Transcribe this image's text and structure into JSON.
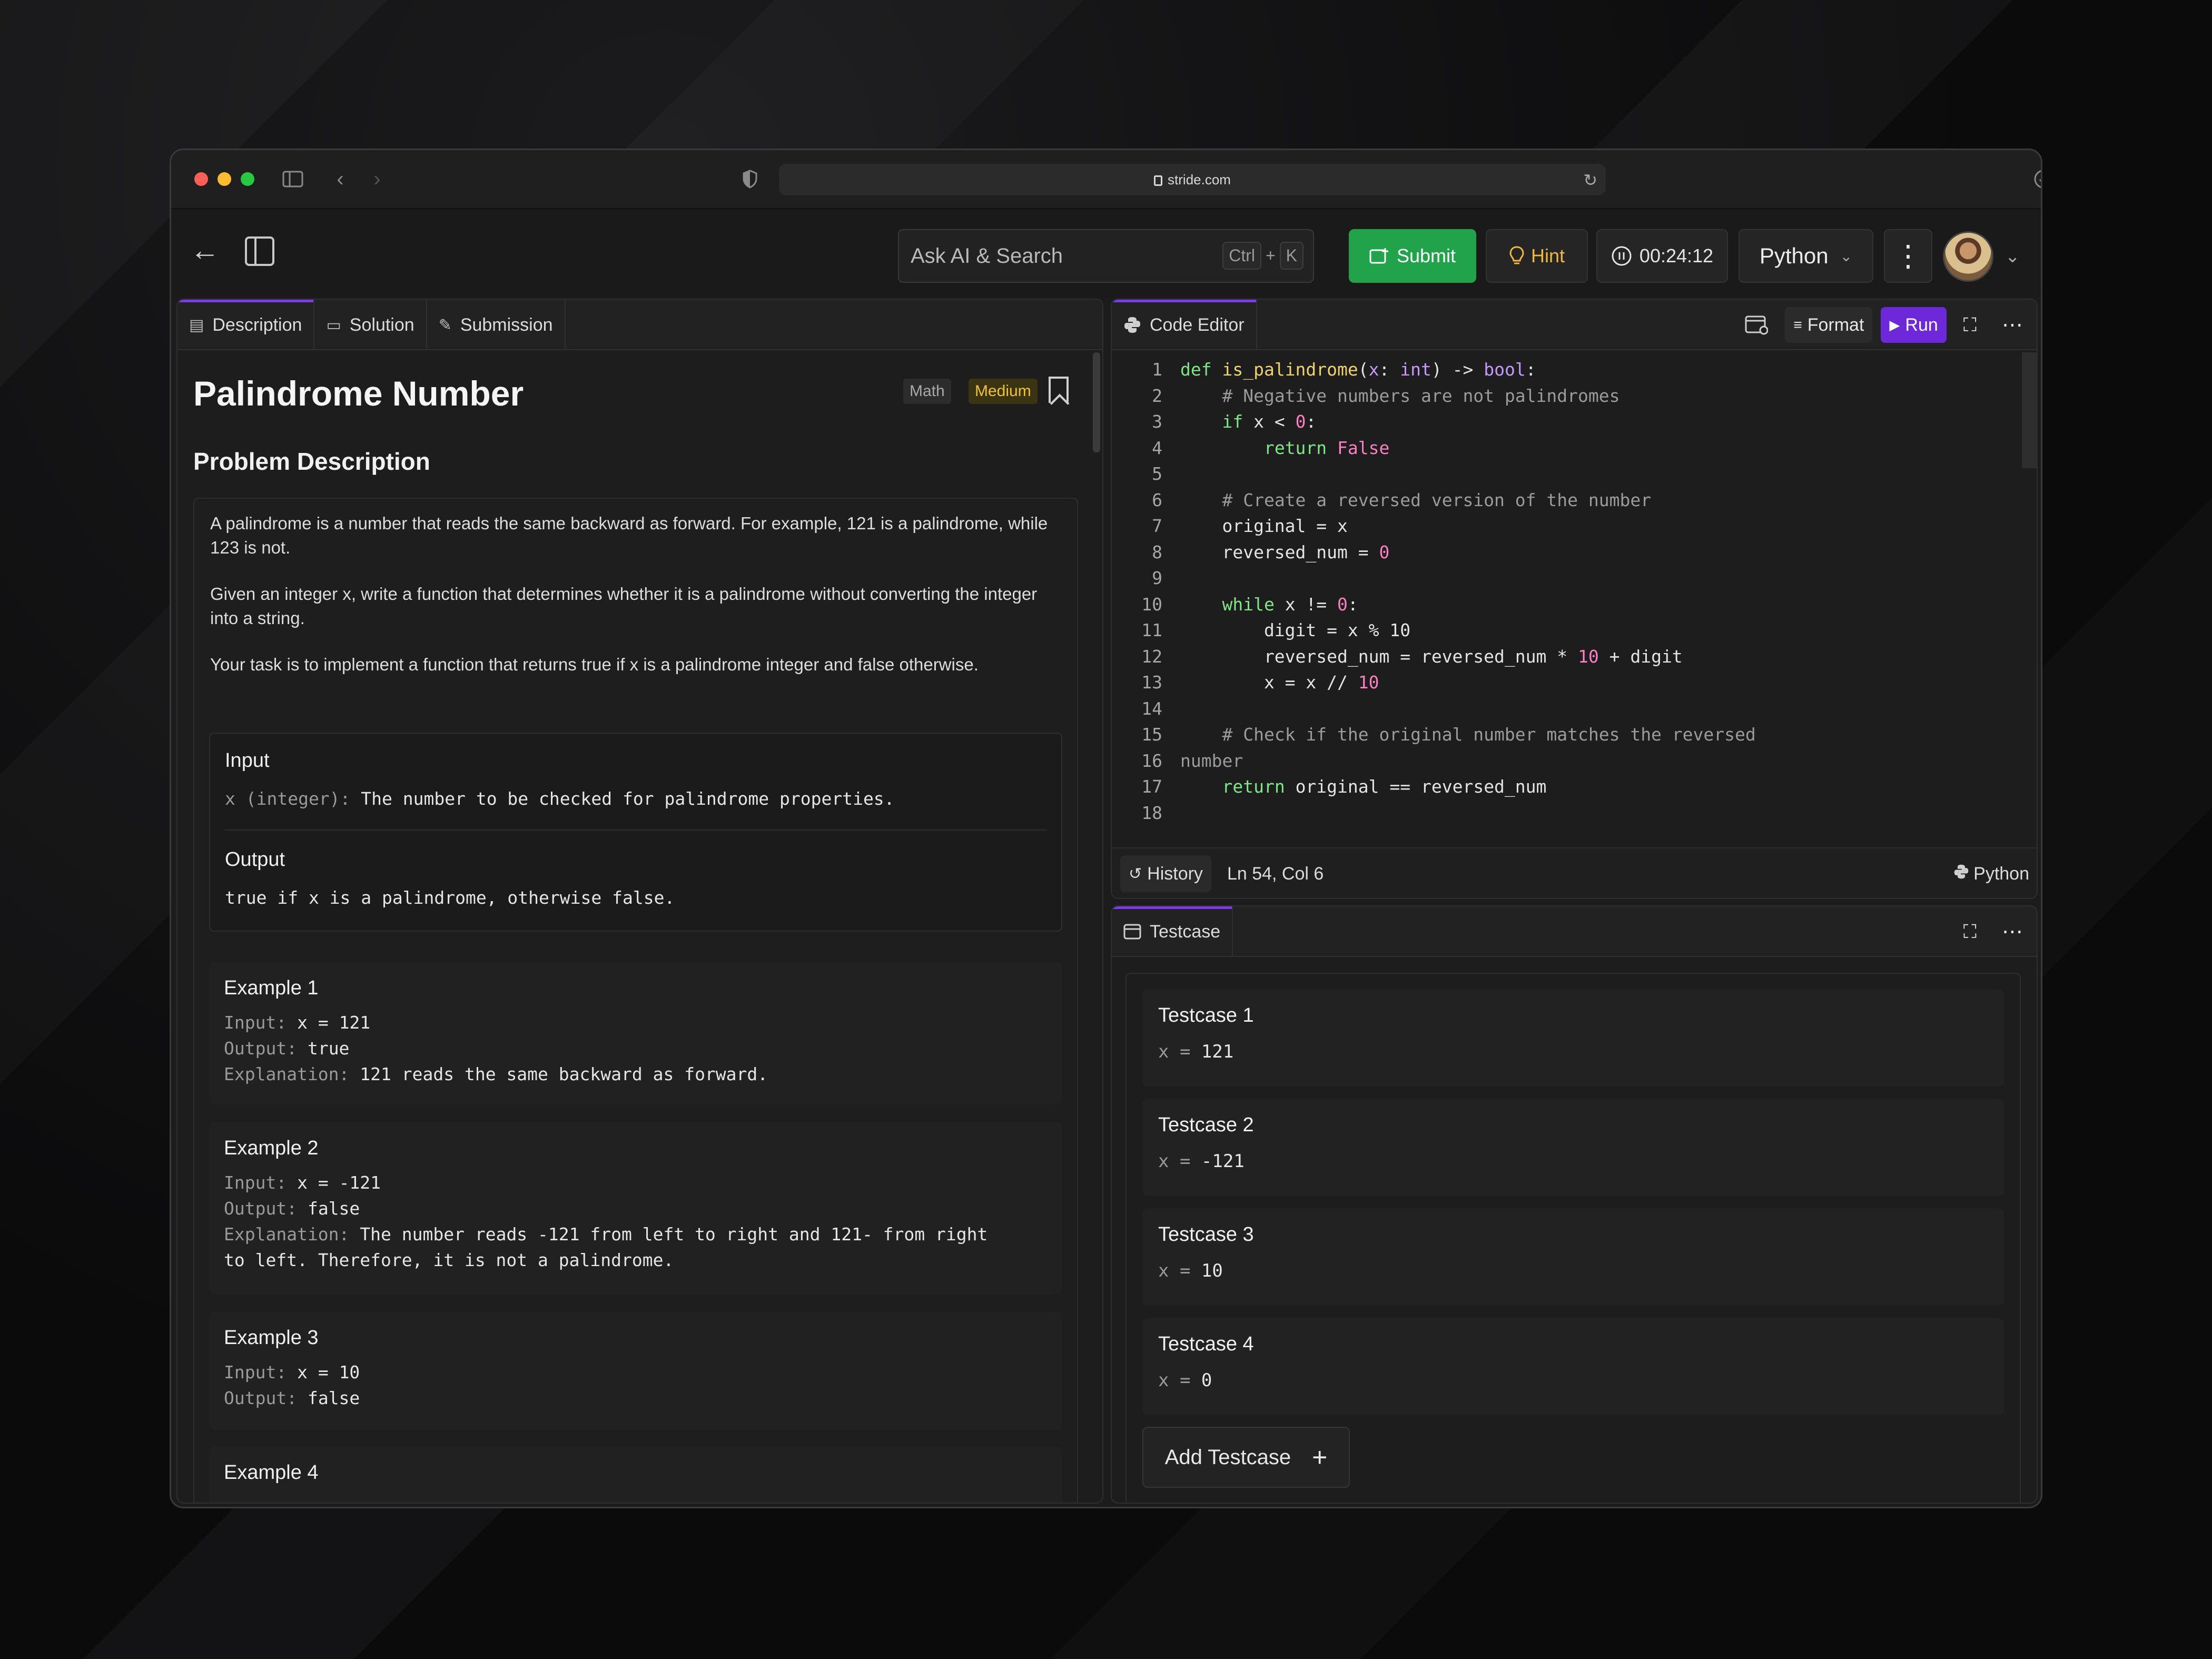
{
  "browser": {
    "url": "stride.com"
  },
  "header": {
    "search_placeholder": "Ask AI & Search",
    "shortcut_ctrl": "Ctrl",
    "shortcut_plus": "+",
    "shortcut_key": "K",
    "submit_label": "Submit",
    "hint_label": "Hint",
    "timer": "00:24:12",
    "language": "Python"
  },
  "left_tabs": [
    "Description",
    "Solution",
    "Submission"
  ],
  "problem": {
    "title": "Palindrome Number",
    "tag_topic": "Math",
    "tag_difficulty": "Medium",
    "section_title": "Problem Description",
    "para1": "A palindrome is a number that reads the same backward as forward. For example, 121 is a palindrome, while 123 is not.",
    "para2": "Given an integer x, write a function that determines whether it is a palindrome without converting the integer into a string.",
    "para3": "Your task is to implement a function that returns true if x is a palindrome integer and false otherwise.",
    "input_heading": "Input",
    "input_param": "x (integer):",
    "input_desc": " The number to be checked for palindrome properties.",
    "output_heading": "Output",
    "output_desc": "true if x is a palindrome, otherwise false."
  },
  "examples": [
    {
      "title": "Example 1",
      "input": "x = 121",
      "output": "true",
      "explanation": "121 reads the same backward as forward."
    },
    {
      "title": "Example 2",
      "input": "x = -121",
      "output": "false",
      "explanation": "The number reads -121 from left to right and 121- from right",
      "explanation2": "to left. Therefore, it is not a palindrome."
    },
    {
      "title": "Example 3",
      "input": "x = 10",
      "output": "false"
    },
    {
      "title": "Example 4"
    }
  ],
  "labels": {
    "input": "Input:",
    "output": "Output:",
    "explanation": "Explanation:"
  },
  "editor": {
    "tab_label": "Code Editor",
    "format_label": "Format",
    "run_label": "Run",
    "history_label": "History",
    "cursor_pos": "Ln 54, Col 6",
    "language": "Python",
    "line_numbers": [
      "1",
      "2",
      "3",
      "4",
      "5",
      "6",
      "7",
      "8",
      "9",
      "10",
      "11",
      "12",
      "13",
      "14",
      "15",
      "16",
      "17",
      "18"
    ]
  },
  "testcase": {
    "tab_label": "Testcase",
    "cases": [
      {
        "title": "Testcase 1",
        "var": "x",
        "value": "121"
      },
      {
        "title": "Testcase 2",
        "var": "x",
        "value": "-121"
      },
      {
        "title": "Testcase 3",
        "var": "x",
        "value": "10"
      },
      {
        "title": "Testcase 4",
        "var": "x",
        "value": "0"
      }
    ],
    "add_label": "Add Testcase"
  },
  "colors": {
    "accent_purple": "#7c3aed",
    "submit_green": "#21a34a",
    "hint_yellow": "#f0b93a",
    "run_purple": "#6d28d9"
  }
}
